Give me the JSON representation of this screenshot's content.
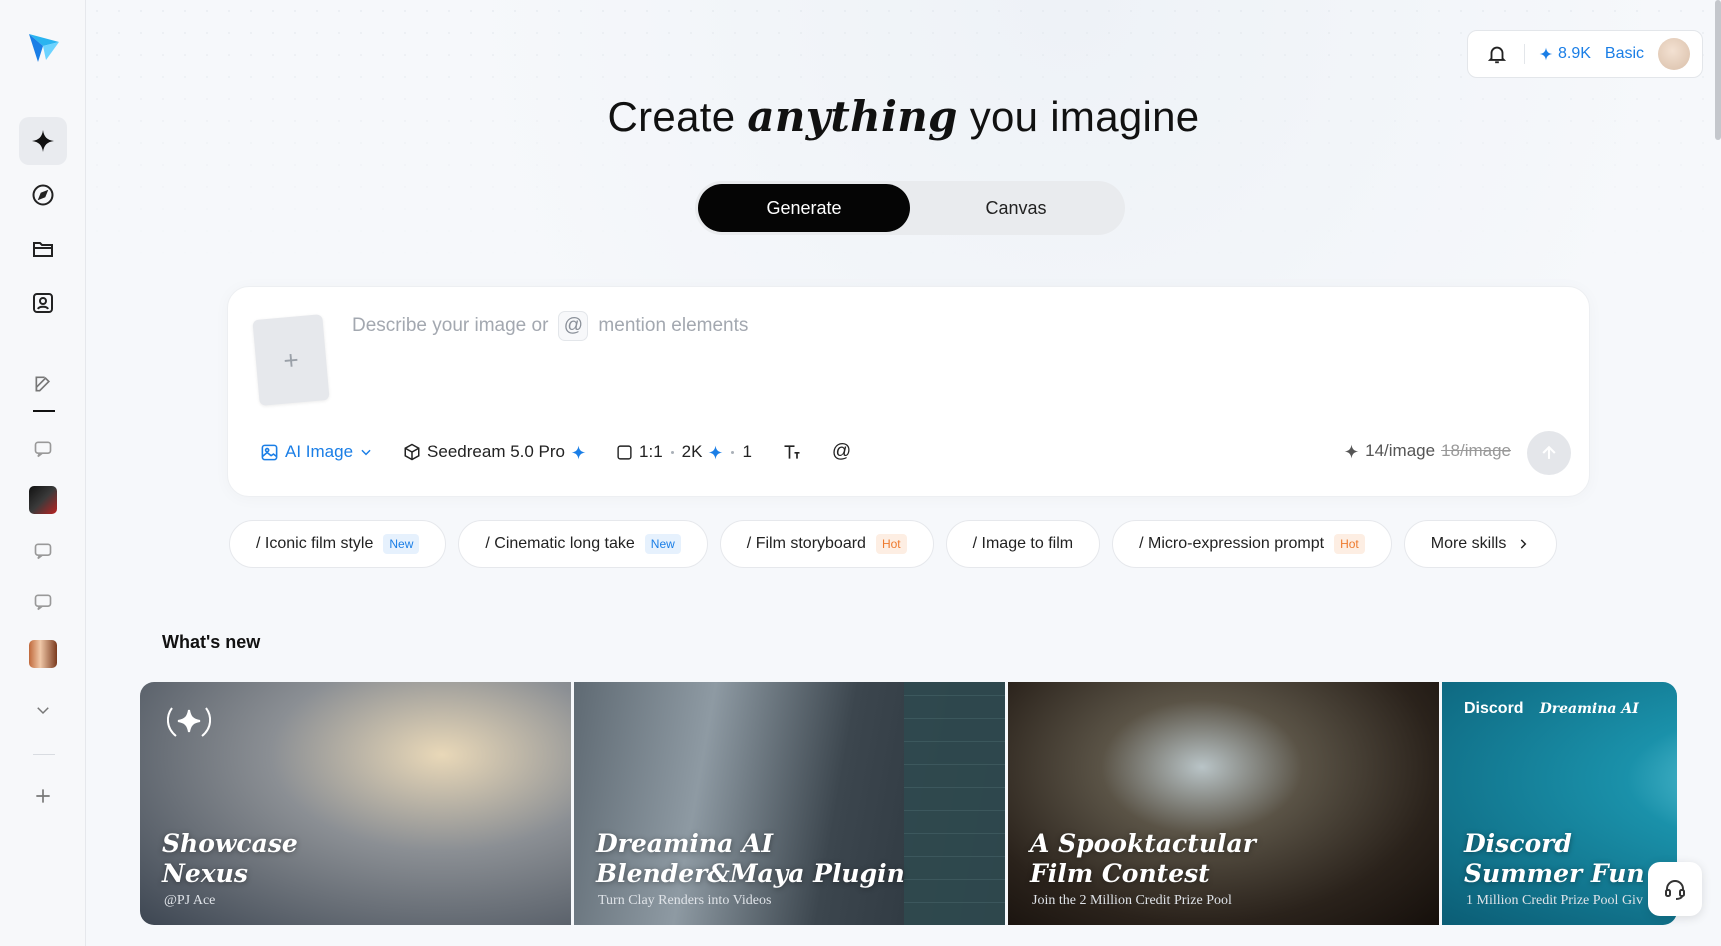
{
  "hero": {
    "prefix": "Create ",
    "emphasis": "anything",
    "suffix": " you imagine"
  },
  "modes": [
    "Generate",
    "Canvas"
  ],
  "active_mode": "Generate",
  "header": {
    "credits": "8.9K",
    "plan": "Basic"
  },
  "prompt": {
    "placeholder_before": "Describe your image or",
    "placeholder_after": "mention elements",
    "at_symbol": "@",
    "add_symbol": "+"
  },
  "toolbar": {
    "type_label": "AI Image",
    "model_label": "Seedream 5.0 Pro",
    "ratio": "1:1",
    "resolution": "2K",
    "count": "1",
    "mention_symbol": "@",
    "cost": "14/image",
    "cost_original": "18/image"
  },
  "skills": [
    {
      "label": "/ Iconic film style",
      "badge": "New",
      "badge_type": "new"
    },
    {
      "label": "/ Cinematic long take",
      "badge": "New",
      "badge_type": "new"
    },
    {
      "label": "/ Film storyboard",
      "badge": "Hot",
      "badge_type": "hot"
    },
    {
      "label": "/ Image to film",
      "badge": "",
      "badge_type": ""
    },
    {
      "label": "/ Micro-expression prompt",
      "badge": "Hot",
      "badge_type": "hot"
    }
  ],
  "more_skills": "More skills",
  "whats_new": {
    "title": "What's new",
    "cards": [
      {
        "title_line1": "Showcase",
        "title_line2": "Nexus",
        "subtitle": "@PJ Ace"
      },
      {
        "title_line1": "Dreamina AI",
        "title_line2": "Blender&Maya Plugin",
        "subtitle": "Turn Clay Renders into Videos"
      },
      {
        "title_line1": "A Spooktactular",
        "title_line2": "Film Contest",
        "subtitle": "Join the 2 Million Credit Prize Pool"
      },
      {
        "title_line1": "Discord",
        "title_line2": "Summer Fun",
        "subtitle": "1 Million Credit Prize Pool Giv",
        "brand1": "Discord",
        "brand2": "Dreamina AI"
      }
    ]
  },
  "colors": {
    "accent": "#1a7ee6",
    "hot": "#ee7a2e",
    "active_mode_bg": "#050505"
  }
}
